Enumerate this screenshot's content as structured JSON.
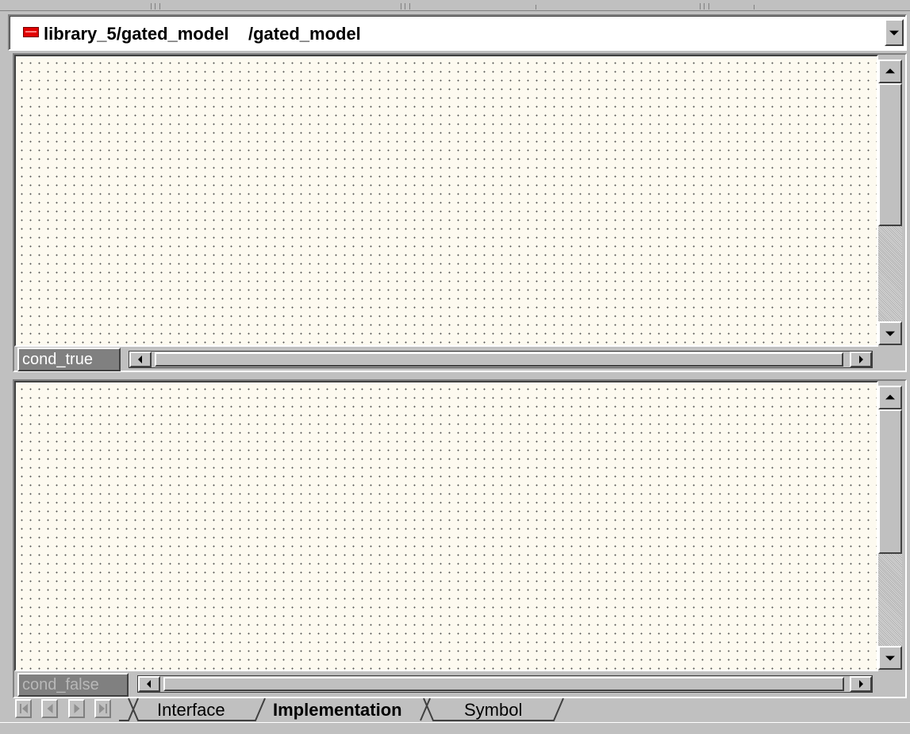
{
  "window": {
    "path_title": "library_5/gated_model    /gated_model"
  },
  "panes": [
    {
      "label": "cond_true",
      "state": "active"
    },
    {
      "label": "cond_false",
      "state": "inactive"
    }
  ],
  "tabs": [
    {
      "label": "Interface",
      "active": false
    },
    {
      "label": "Implementation",
      "active": true
    },
    {
      "label": "Symbol",
      "active": false
    }
  ],
  "icons": {
    "model": "model-block-icon",
    "dropdown": "chevron-down-icon",
    "nav": [
      "first-tab-icon",
      "prev-tab-icon",
      "next-tab-icon",
      "last-tab-icon"
    ]
  },
  "colors": {
    "canvas_bg": "#fdfaf0",
    "model_icon": "#e00000",
    "chrome": "#c0c0c0"
  }
}
